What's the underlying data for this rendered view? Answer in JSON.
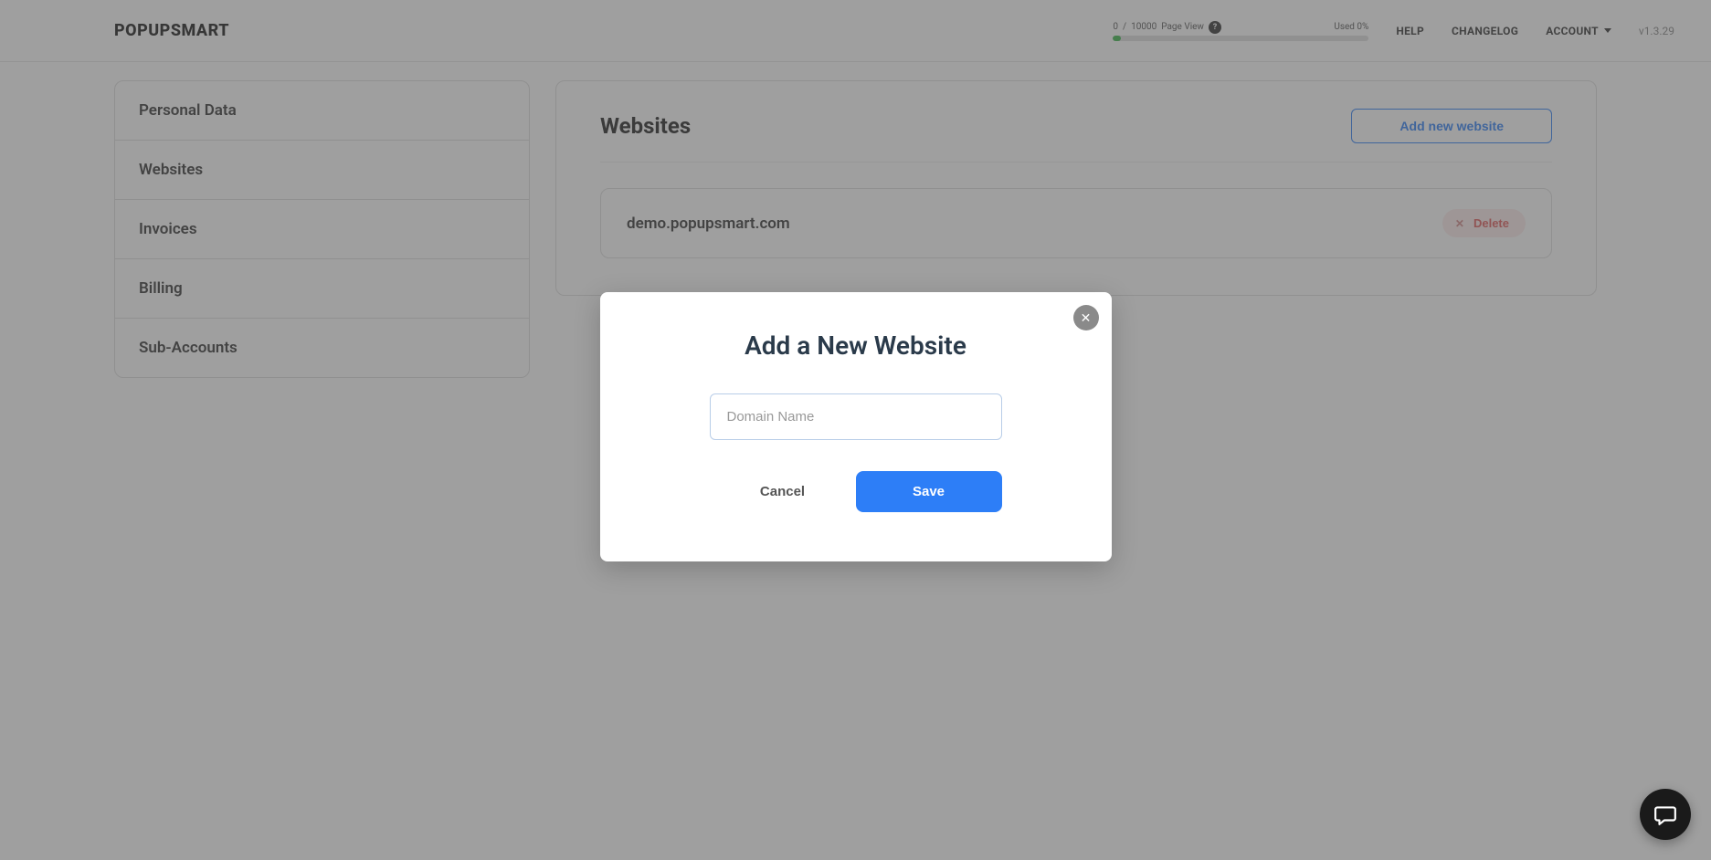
{
  "header": {
    "logo": "POPUPSMART",
    "usage": {
      "current": "0",
      "separator": "/",
      "max": "10000",
      "label": "Page View",
      "used_label": "Used 0%"
    },
    "nav": {
      "help": "HELP",
      "changelog": "CHANGELOG",
      "account": "ACCOUNT"
    },
    "version": "v1.3.29"
  },
  "sidebar": {
    "items": [
      {
        "label": "Personal Data"
      },
      {
        "label": "Websites"
      },
      {
        "label": "Invoices"
      },
      {
        "label": "Billing"
      },
      {
        "label": "Sub-Accounts"
      }
    ]
  },
  "main": {
    "title": "Websites",
    "add_button": "Add new website",
    "websites": [
      {
        "domain": "demo.popupsmart.com",
        "delete_label": "Delete"
      }
    ]
  },
  "modal": {
    "title": "Add a New Website",
    "input_placeholder": "Domain Name",
    "cancel": "Cancel",
    "save": "Save"
  }
}
